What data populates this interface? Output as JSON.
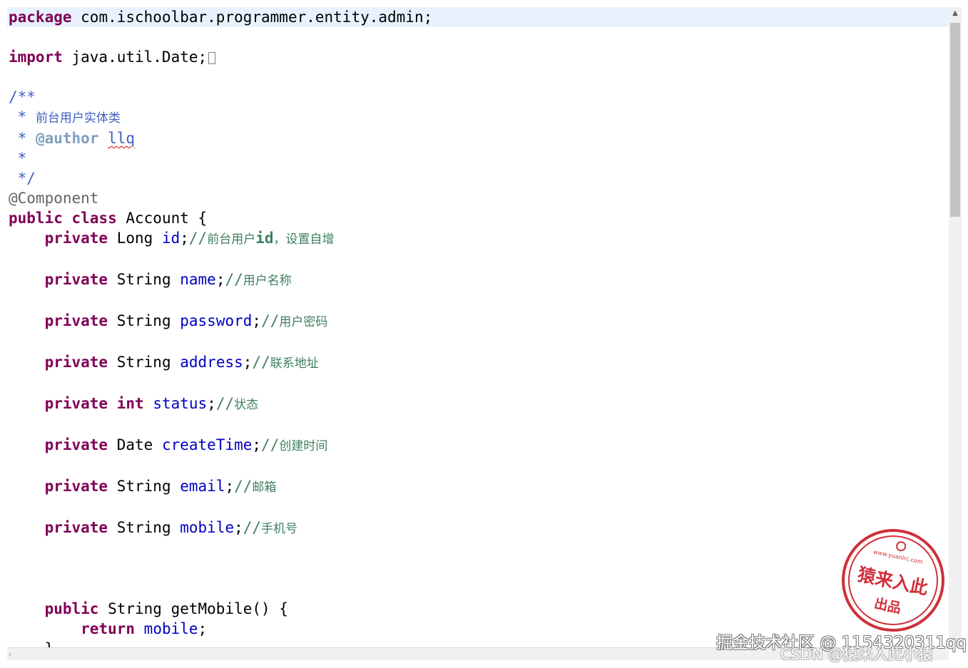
{
  "code": {
    "line1": {
      "kw": "package",
      "text": " com.ischoolbar.programmer.entity.admin;"
    },
    "line3": {
      "kw": "import",
      "text": " java.util.Date;"
    },
    "javadoc": {
      "open": "/**",
      "desc_star": " * ",
      "desc": "前台用户实体类",
      "author_star": " * ",
      "author_tag": "@author",
      "author_sp": " ",
      "author_name": "llq",
      "blank": " *",
      "close": " */"
    },
    "annotation": "@Component",
    "class_decl": {
      "kw1": "public",
      "kw2": "class",
      "name": " Account {"
    },
    "fields": [
      {
        "indent": "    ",
        "kw": "private",
        "kw2": "",
        "type": " Long ",
        "name": "id",
        "semi": ";",
        "slashes": "//",
        "comment": "前台用户",
        "comment_bold": "id",
        "comment_rest": "，设置自增"
      },
      {
        "indent": "    ",
        "kw": "private",
        "kw2": "",
        "type": " String ",
        "name": "name",
        "semi": ";",
        "slashes": "//",
        "comment": "用户名称",
        "comment_bold": "",
        "comment_rest": ""
      },
      {
        "indent": "    ",
        "kw": "private",
        "kw2": "",
        "type": " String ",
        "name": "password",
        "semi": ";",
        "slashes": "//",
        "comment": "用户密码",
        "comment_bold": "",
        "comment_rest": ""
      },
      {
        "indent": "    ",
        "kw": "private",
        "kw2": "",
        "type": " String ",
        "name": "address",
        "semi": ";",
        "slashes": "//",
        "comment": "联系地址",
        "comment_bold": "",
        "comment_rest": ""
      },
      {
        "indent": "    ",
        "kw": "private",
        "kw2": " int",
        "type": " ",
        "name": "status",
        "semi": ";",
        "slashes": "//",
        "comment": "状态",
        "comment_bold": "",
        "comment_rest": ""
      },
      {
        "indent": "    ",
        "kw": "private",
        "kw2": "",
        "type": " Date ",
        "name": "createTime",
        "semi": ";",
        "slashes": "//",
        "comment": "创建时间",
        "comment_bold": "",
        "comment_rest": ""
      },
      {
        "indent": "    ",
        "kw": "private",
        "kw2": "",
        "type": " String ",
        "name": "email",
        "semi": ";",
        "slashes": "//",
        "comment": "邮箱",
        "comment_bold": "",
        "comment_rest": ""
      },
      {
        "indent": "    ",
        "kw": "private",
        "kw2": "",
        "type": " String ",
        "name": "mobile",
        "semi": ";",
        "slashes": "//",
        "comment": "手机号",
        "comment_bold": "",
        "comment_rest": ""
      }
    ],
    "method": {
      "indent": "    ",
      "kw": "public",
      "sig": " String getMobile() {",
      "ret_indent": "        ",
      "ret_kw": "return",
      "ret_sp": " ",
      "ret_field": "mobile",
      "ret_semi": ";",
      "close": "    }"
    }
  },
  "stamp": {
    "url": "www.yuanlrc.com",
    "name": "猿来入此",
    "sub": "出品"
  },
  "watermarks": {
    "juejin": "掘金技术社区 @ 1154320311qq",
    "csdn": "CSDN @猿来入此小猿"
  },
  "icons": {
    "scroll_up": "chevron-up-icon",
    "scroll_left": "chevron-left-icon",
    "fold": "fold-marker-icon",
    "stamp": "apple-logo-icon"
  },
  "colors": {
    "keyword": "#7f0055",
    "field": "#0000c0",
    "comment": "#3f7f5f",
    "javadoc": "#3f5fbf",
    "javadoc_tag": "#7f9fbf",
    "annotation": "#646464",
    "current_line": "#e8f2fe",
    "stamp": "#d0303a"
  }
}
